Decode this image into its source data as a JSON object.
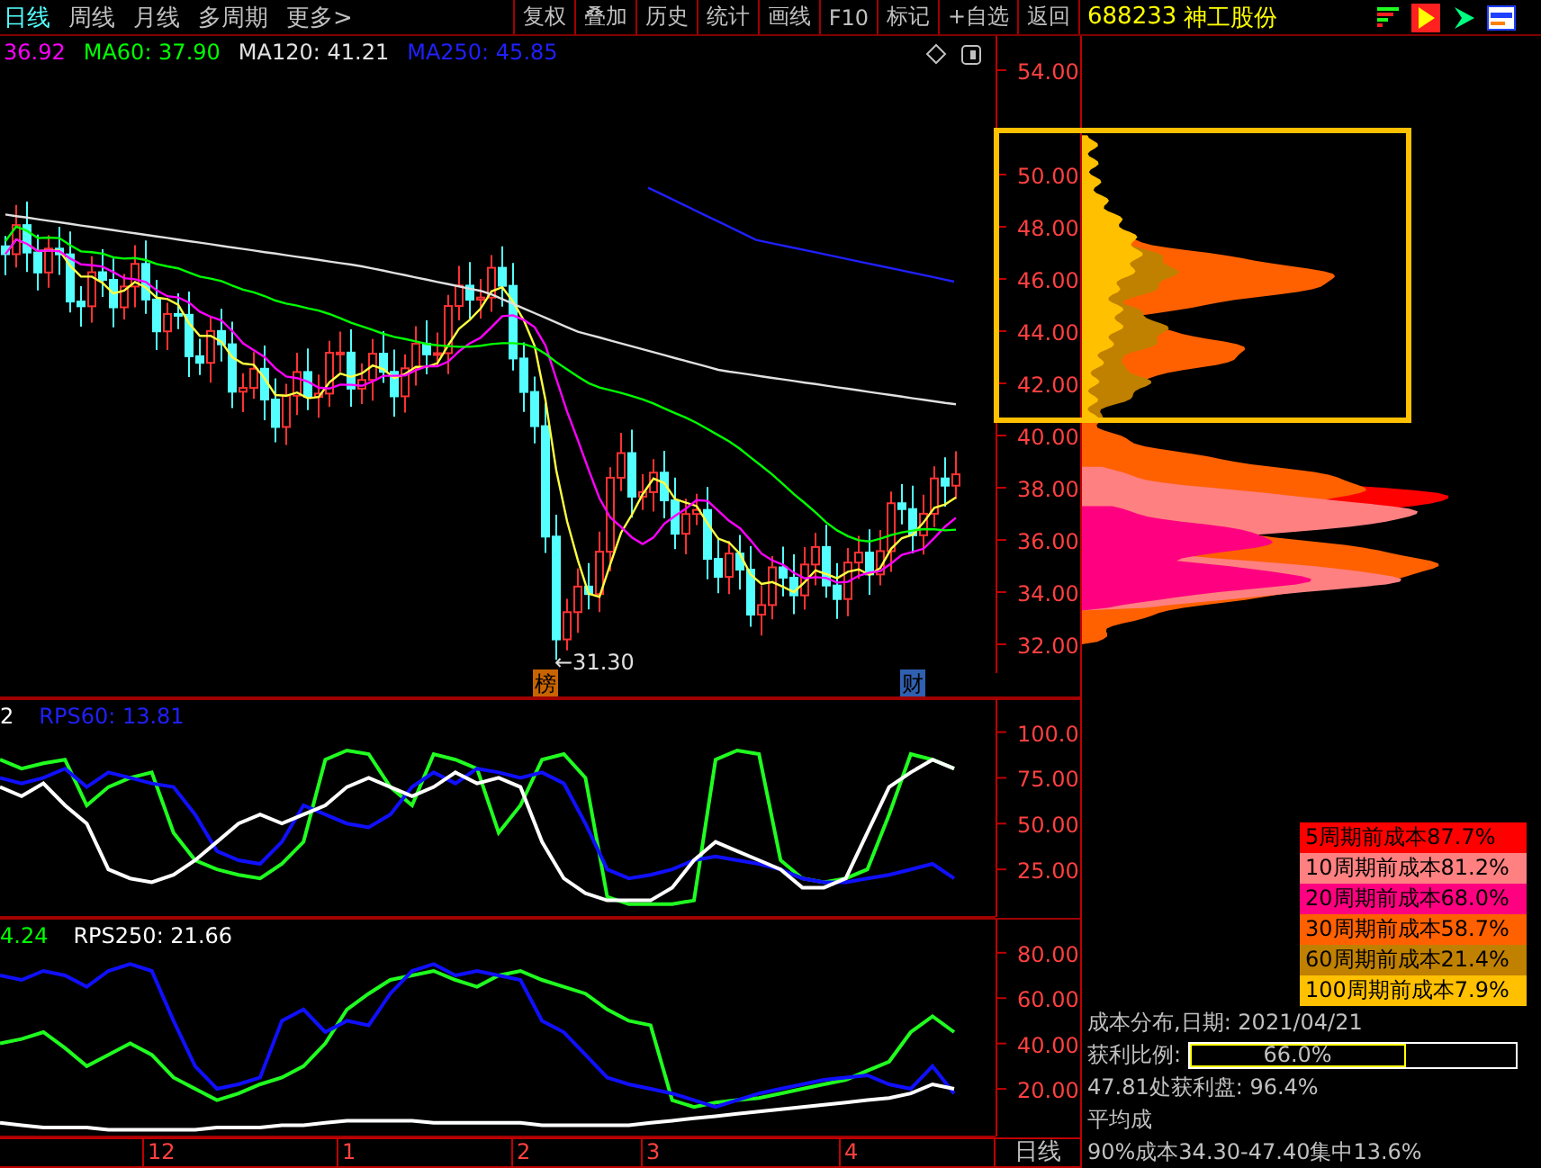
{
  "toolbar": {
    "periods": [
      {
        "label": "日线",
        "selected": true
      },
      {
        "label": "周线",
        "selected": false
      },
      {
        "label": "月线",
        "selected": false
      },
      {
        "label": "多周期",
        "selected": false
      },
      {
        "label": "更多>",
        "selected": false
      }
    ],
    "buttons": [
      "复权",
      "叠加",
      "历史",
      "统计",
      "画线",
      "F10",
      "标记",
      "+自选",
      "返回"
    ],
    "stock_code": "688233",
    "stock_name": "神工股份"
  },
  "price_chart": {
    "legend": [
      {
        "label": "36.92",
        "color": "#ff00ff"
      },
      {
        "label": "MA60: 37.90",
        "color": "#00ff00"
      },
      {
        "label": "MA120: 41.21",
        "color": "#e0e0e0"
      },
      {
        "label": "MA250: 45.85",
        "color": "#2020ff"
      }
    ],
    "axis_labels": [
      "54.00",
      "50.00",
      "48.00",
      "46.00",
      "44.00",
      "42.00",
      "40.00",
      "38.00",
      "36.00",
      "34.00",
      "32.00"
    ],
    "low_marker": "←31.30",
    "event_badges": [
      {
        "label": "榜",
        "color": "#c86400"
      },
      {
        "label": "财",
        "color": "#3060b0"
      }
    ]
  },
  "rps_panels": [
    {
      "legend": [
        {
          "label": "2",
          "color": "#ffffff"
        },
        {
          "label": "RPS60: 13.81",
          "color": "#2020ff"
        }
      ],
      "chart_data": {
        "type": "line",
        "ylim": [
          -1,
          118
        ],
        "yticks": [
          {
            "value": 100,
            "label": "100.0"
          },
          {
            "value": 75,
            "label": "75.00"
          },
          {
            "value": 50,
            "label": "50.00"
          },
          {
            "value": 25,
            "label": "25.00"
          }
        ],
        "series": [
          {
            "color": "#20ff20",
            "values": [
              85,
              80,
              83,
              85,
              60,
              70,
              75,
              78,
              45,
              30,
              25,
              22,
              20,
              28,
              40,
              85,
              90,
              88,
              70,
              60,
              88,
              85,
              80,
              45,
              60,
              85,
              88,
              75,
              10,
              6,
              6,
              6,
              8,
              85,
              90,
              88,
              30,
              20,
              18,
              20,
              25,
              55,
              88,
              85,
              80
            ]
          },
          {
            "color": "#1010ff",
            "values": [
              75,
              72,
              75,
              80,
              70,
              78,
              75,
              72,
              70,
              55,
              35,
              30,
              28,
              40,
              60,
              55,
              50,
              48,
              55,
              70,
              78,
              72,
              80,
              78,
              75,
              78,
              72,
              50,
              25,
              20,
              22,
              25,
              30,
              32,
              30,
              28,
              25,
              20,
              18,
              18,
              20,
              22,
              25,
              28,
              20
            ]
          },
          {
            "color": "#ffffff",
            "values": [
              70,
              65,
              72,
              60,
              50,
              25,
              20,
              18,
              22,
              30,
              40,
              50,
              55,
              50,
              55,
              60,
              70,
              75,
              70,
              65,
              70,
              78,
              72,
              75,
              70,
              40,
              20,
              12,
              8,
              8,
              8,
              15,
              30,
              40,
              35,
              30,
              25,
              15,
              15,
              20,
              45,
              70,
              78,
              85,
              80
            ]
          }
        ]
      }
    },
    {
      "legend": [
        {
          "label": "4.24",
          "color": "#00ff00"
        },
        {
          "label": "RPS250: 21.66",
          "color": "#ffffff"
        }
      ],
      "chart_data": {
        "type": "line",
        "ylim": [
          -1,
          95
        ],
        "yticks": [
          {
            "value": 80,
            "label": "80.00"
          },
          {
            "value": 60,
            "label": "60.00"
          },
          {
            "value": 40,
            "label": "40.00"
          },
          {
            "value": 20,
            "label": "20.00"
          }
        ],
        "series": [
          {
            "color": "#20ff20",
            "values": [
              40,
              42,
              45,
              38,
              30,
              35,
              40,
              35,
              25,
              20,
              15,
              18,
              22,
              25,
              30,
              40,
              55,
              62,
              68,
              70,
              72,
              68,
              65,
              70,
              72,
              68,
              65,
              62,
              55,
              50,
              48,
              15,
              12,
              14,
              15,
              16,
              18,
              20,
              22,
              24,
              28,
              32,
              45,
              52,
              45
            ]
          },
          {
            "color": "#1010ff",
            "values": [
              70,
              68,
              72,
              70,
              65,
              72,
              75,
              72,
              50,
              30,
              20,
              22,
              25,
              50,
              55,
              45,
              50,
              48,
              62,
              72,
              75,
              70,
              72,
              70,
              68,
              50,
              45,
              35,
              25,
              22,
              20,
              18,
              15,
              12,
              15,
              18,
              20,
              22,
              24,
              25,
              26,
              22,
              20,
              30,
              18
            ]
          },
          {
            "color": "#ffffff",
            "values": [
              5,
              4,
              3,
              3,
              3,
              2,
              2,
              2,
              2,
              2,
              3,
              3,
              3,
              4,
              4,
              5,
              6,
              6,
              6,
              6,
              5,
              5,
              5,
              5,
              5,
              4,
              4,
              4,
              4,
              4,
              5,
              6,
              7,
              8,
              9,
              10,
              11,
              12,
              13,
              14,
              15,
              16,
              18,
              22,
              20
            ]
          }
        ]
      }
    }
  ],
  "time_axis": {
    "months": [
      "12",
      "1",
      "2",
      "3",
      "4"
    ],
    "period": "日线"
  },
  "chip_distribution": {
    "legend": [
      {
        "label": "5周期前成本87.7%",
        "color": "#ff0000"
      },
      {
        "label": "10周期前成本81.2%",
        "color": "#ff8080"
      },
      {
        "label": "20周期前成本68.0%",
        "color": "#ff0080"
      },
      {
        "label": "30周期前成本58.7%",
        "color": "#ff6000"
      },
      {
        "label": "60周期前成本21.4%",
        "color": "#c08000"
      },
      {
        "label": "100周期前成本7.9%",
        "color": "#ffc000"
      }
    ],
    "date_label": "成本分布,日期: 2021/04/21",
    "profit_label": "获利比例:",
    "profit_ratio": {
      "level": 0.66,
      "reading": "66.0%"
    },
    "stats": [
      "47.81处获利盘: 96.4%",
      "平均成",
      "90%成本34.30-47.40集中13.6%"
    ]
  }
}
